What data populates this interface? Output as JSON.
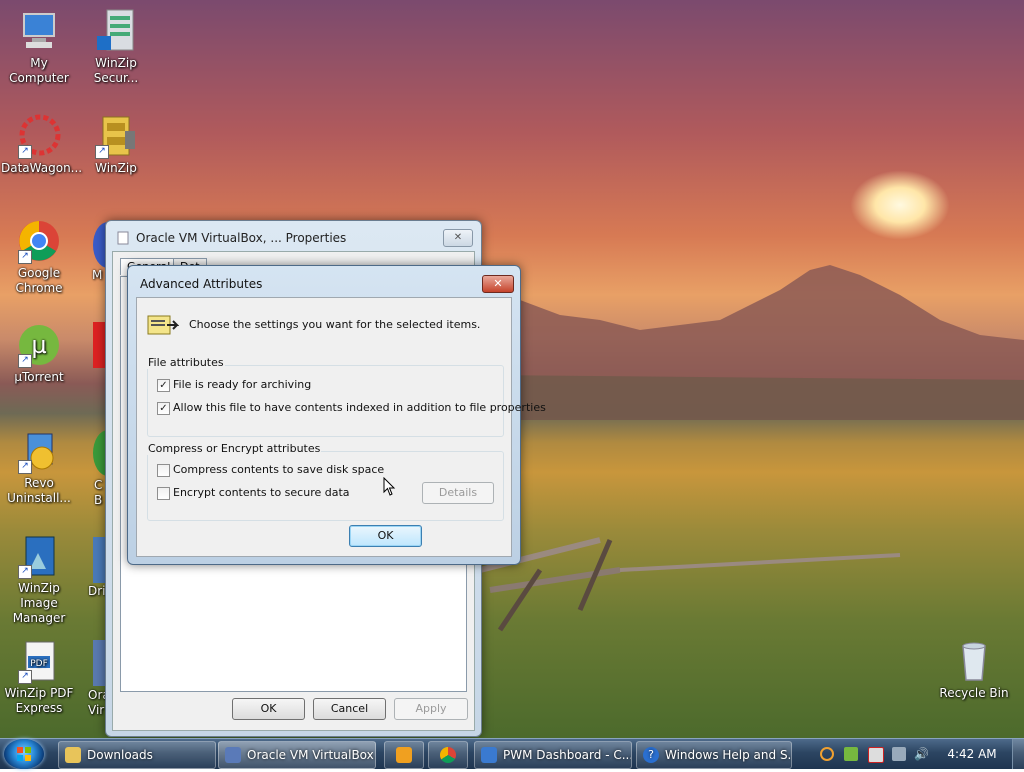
{
  "desktop": {
    "icons": [
      {
        "label": "My Computer",
        "icon": "computer-icon"
      },
      {
        "label": "WinZip Secur...",
        "icon": "server-icon"
      },
      {
        "label": "DataWagon...",
        "icon": "datawagon-icon"
      },
      {
        "label": "WinZip",
        "icon": "winzip-icon"
      },
      {
        "label": "Google Chrome",
        "icon": "chrome-icon"
      },
      {
        "label": "µTorrent",
        "icon": "utorrent-icon"
      },
      {
        "label": "Revo Uninstall...",
        "icon": "revo-icon"
      },
      {
        "label": "WinZip Image Manager",
        "icon": "image-manager-icon"
      },
      {
        "label": "WinZip PDF Express",
        "icon": "pdf-icon"
      },
      {
        "label": "Recycle Bin",
        "icon": "recycle-bin-icon"
      }
    ],
    "partial_labels": [
      "M",
      "C",
      "B",
      "Dri",
      "Ora",
      "Vir"
    ]
  },
  "properties_window": {
    "title": "Oracle VM VirtualBox, ... Properties",
    "tabs": [
      "General",
      "Det"
    ],
    "ok_label": "OK",
    "cancel_label": "Cancel",
    "apply_label": "Apply"
  },
  "advanced_dialog": {
    "title": "Advanced Attributes",
    "close_label": "✕",
    "instruction": "Choose the settings you want for the selected items.",
    "file_attributes": {
      "title": "File attributes",
      "options": [
        {
          "label": "File is ready for archiving",
          "checked": true
        },
        {
          "label": "Allow this file to have contents indexed in addition to file properties",
          "checked": true
        }
      ]
    },
    "compress_encrypt": {
      "title": "Compress or Encrypt attributes",
      "options": [
        {
          "label": "Compress contents to save disk space",
          "checked": false
        },
        {
          "label": "Encrypt contents to secure data",
          "checked": false
        }
      ],
      "details_label": "Details"
    },
    "ok_label": "OK"
  },
  "taskbar": {
    "items": [
      {
        "label": "Downloads",
        "icon": "folder-icon"
      },
      {
        "label": "Oracle VM VirtualBox...",
        "icon": "virtualbox-icon"
      },
      {
        "label": "",
        "icon": "media-player-icon"
      },
      {
        "label": "",
        "icon": "chrome-icon"
      },
      {
        "label": "PWM Dashboard - C...",
        "icon": "browser-icon"
      },
      {
        "label": "Windows Help and S...",
        "icon": "help-icon"
      }
    ],
    "clock": "4:42 AM"
  },
  "colors": {
    "accent": "#3c7fb1",
    "close_red": "#c5432b",
    "taskbar": "#2c4562"
  }
}
